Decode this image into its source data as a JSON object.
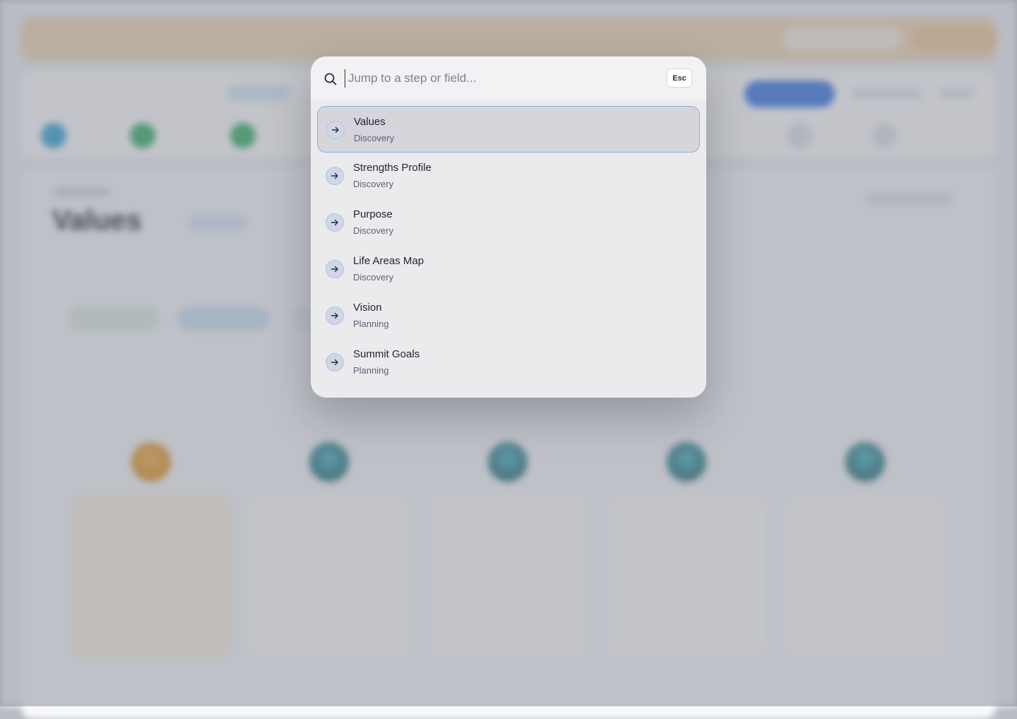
{
  "palette": {
    "search": {
      "placeholder": "Jump to a step or field..."
    },
    "esc_label": "Esc",
    "results": [
      {
        "title": "Values",
        "section": "Discovery",
        "active": true
      },
      {
        "title": "Strengths Profile",
        "section": "Discovery",
        "active": false
      },
      {
        "title": "Purpose",
        "section": "Discovery",
        "active": false
      },
      {
        "title": "Life Areas Map",
        "section": "Discovery",
        "active": false
      },
      {
        "title": "Vision",
        "section": "Planning",
        "active": false
      },
      {
        "title": "Summit Goals",
        "section": "Planning",
        "active": false
      }
    ]
  },
  "background": {
    "page_title": "Values"
  },
  "colors": {
    "accent": "#3b79e6",
    "active_border": "#8eb0e0",
    "banner": "#f3d9b8"
  }
}
